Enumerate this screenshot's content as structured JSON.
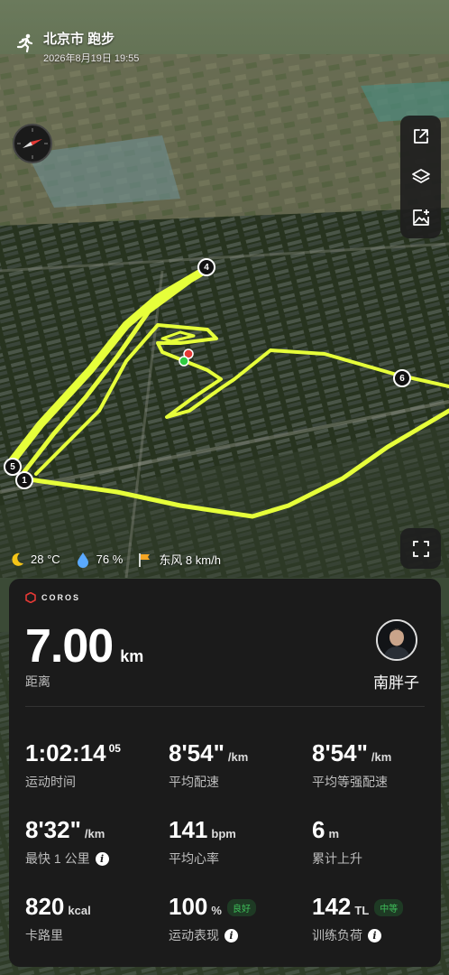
{
  "header": {
    "title": "北京市 跑步",
    "datetime": "2026年8月19日 19:55"
  },
  "route": {
    "markers": [
      "1",
      "4",
      "5",
      "6"
    ],
    "track_color": "#e6ff3a"
  },
  "map_tools": {
    "icons": [
      "share-icon",
      "layers-icon",
      "add-photo-icon"
    ],
    "fullscreen_icon": "fullscreen-icon"
  },
  "weather": {
    "temperature": "28 °C",
    "humidity": "76 %",
    "wind": "东风 8 km/h"
  },
  "card": {
    "brand": "COROS",
    "distance": {
      "value": "7.00",
      "unit": "km",
      "label": "距离"
    },
    "user": {
      "name": "南胖子"
    },
    "stats": [
      {
        "value": "1:02:14",
        "sup": "05",
        "unit": "",
        "label": "运动时间"
      },
      {
        "value": "8'54\"",
        "sup": "",
        "unit": "/km",
        "label": "平均配速"
      },
      {
        "value": "8'54\"",
        "sup": "",
        "unit": "/km",
        "label": "平均等强配速"
      },
      {
        "value": "8'32\"",
        "sup": "",
        "unit": "/km",
        "label": "最快 1 公里"
      },
      {
        "value": "141",
        "sup": "",
        "unit": "bpm",
        "label": "平均心率"
      },
      {
        "value": "6",
        "sup": "",
        "unit": "m",
        "label": "累计上升"
      },
      {
        "value": "820",
        "sup": "",
        "unit": "kcal",
        "label": "卡路里"
      },
      {
        "value": "100",
        "sup": "",
        "unit": "%",
        "label": "运动表现",
        "badge": "良好"
      },
      {
        "value": "142",
        "sup": "",
        "unit": "TL",
        "label": "训练负荷",
        "badge": "中等"
      }
    ]
  }
}
